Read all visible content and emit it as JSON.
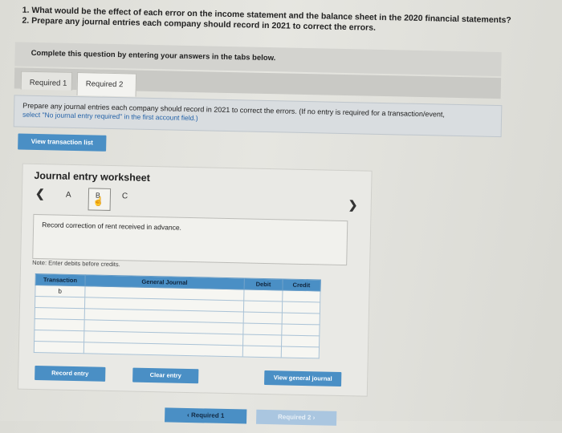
{
  "question": {
    "line1": "1. What would be the effect of each error on the income statement and the balance sheet in the 2020 financial statements?",
    "line2": "2. Prepare any journal entries each company should record in 2021 to correct the errors."
  },
  "complete_banner": "Complete this question by entering your answers in the tabs below.",
  "tabs": [
    {
      "label": "Required 1"
    },
    {
      "label": "Required 2"
    }
  ],
  "instructions": {
    "line1": "Prepare any journal entries each company should record in 2021 to correct the errors. (If no entry is required for a transaction/event,",
    "line2": "select \"No journal entry required\" in the first account field.)"
  },
  "view_transaction_list": "View transaction list",
  "worksheet": {
    "title": "Journal entry worksheet",
    "prev_icon": "chevron-left-icon",
    "next_icon": "chevron-right-icon",
    "entries": [
      {
        "label": "A"
      },
      {
        "label": "B"
      },
      {
        "label": "C"
      }
    ],
    "description": "Record correction of rent received in advance.",
    "note": "Note: Enter debits before credits.",
    "table": {
      "headers": [
        "Transaction",
        "General Journal",
        "Debit",
        "Credit"
      ],
      "rows": [
        [
          "b",
          "",
          "",
          ""
        ],
        [
          "",
          "",
          "",
          ""
        ],
        [
          "",
          "",
          "",
          ""
        ],
        [
          "",
          "",
          "",
          ""
        ],
        [
          "",
          "",
          "",
          ""
        ],
        [
          "",
          "",
          "",
          ""
        ]
      ]
    },
    "record_entry": "Record entry",
    "clear_entry": "Clear entry",
    "view_general_journal": "View general journal"
  },
  "bottom_nav": {
    "prev_label": "Required 1",
    "next_label": "Required 2"
  }
}
